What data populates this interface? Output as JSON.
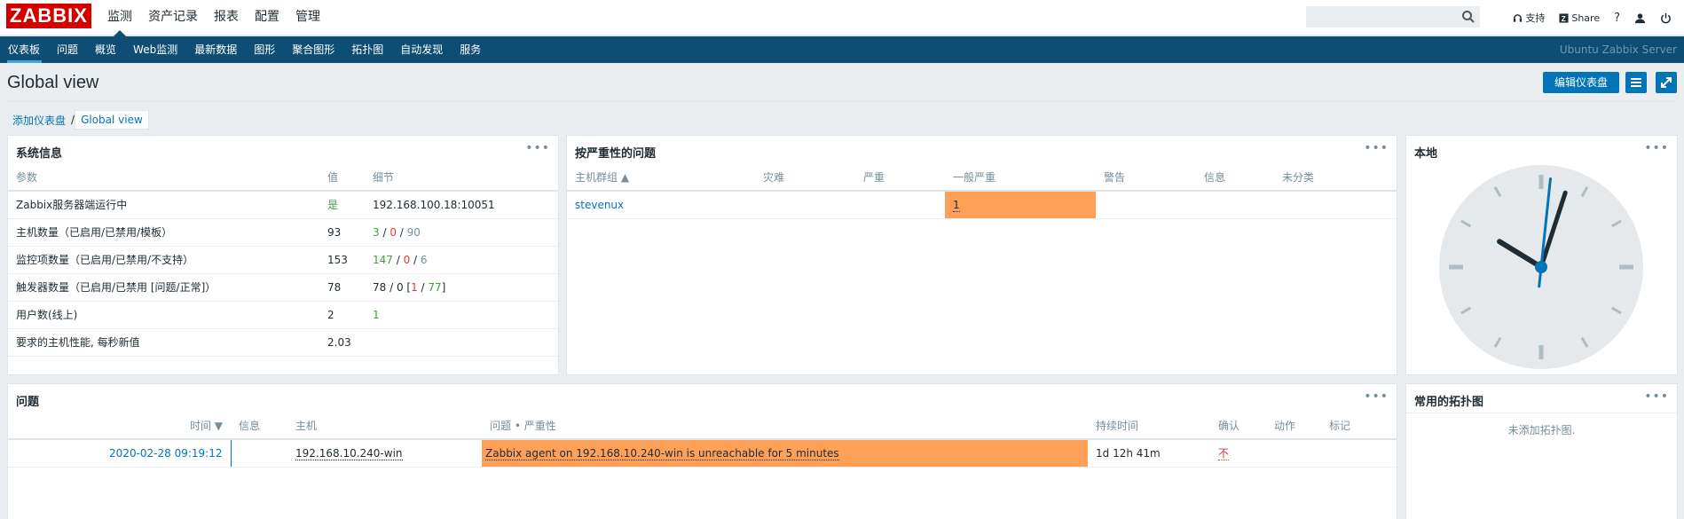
{
  "logo": "ZABBIX",
  "top_menu": [
    {
      "label": "监测",
      "active": true
    },
    {
      "label": "资产记录",
      "active": false
    },
    {
      "label": "报表",
      "active": false
    },
    {
      "label": "配置",
      "active": false
    },
    {
      "label": "管理",
      "active": false
    }
  ],
  "top_links": {
    "support": "支持",
    "share": "Share",
    "help": "?"
  },
  "sub_menu": [
    {
      "label": "仪表板",
      "active": true
    },
    {
      "label": "问题",
      "active": false
    },
    {
      "label": "概览",
      "active": false
    },
    {
      "label": "Web监测",
      "active": false
    },
    {
      "label": "最新数据",
      "active": false
    },
    {
      "label": "图形",
      "active": false
    },
    {
      "label": "聚合图形",
      "active": false
    },
    {
      "label": "拓扑图",
      "active": false
    },
    {
      "label": "自动发现",
      "active": false
    },
    {
      "label": "服务",
      "active": false
    }
  ],
  "server_name": "Ubuntu Zabbix Server",
  "page": {
    "title": "Global view",
    "edit_button": "编辑仪表盘"
  },
  "breadcrumb": {
    "parent": "添加仪表盘",
    "separator": "/",
    "current": "Global view"
  },
  "sysinfo": {
    "title": "系统信息",
    "menu": "•••",
    "columns": [
      "参数",
      "值",
      "细节"
    ],
    "rows": [
      {
        "param": "Zabbix服务器端运行中",
        "value": "是",
        "detail": "192.168.100.18:10051"
      },
      {
        "param": "主机数量（已启用/已禁用/模板）",
        "value": "93",
        "d1": "3",
        "d2": "0",
        "d3": "90"
      },
      {
        "param": "监控项数量（已启用/已禁用/不支持）",
        "value": "153",
        "d1": "147",
        "d2": "0",
        "d3": "6"
      },
      {
        "param": "触发器数量（已启用/已禁用 [问题/正常]）",
        "value": "78",
        "d_pre": "78 / 0 [",
        "d1": "1",
        "d_mid": " / ",
        "d2": "77",
        "d_post": "]"
      },
      {
        "param": "用户数(线上)",
        "value": "2",
        "detail": "1"
      },
      {
        "param": "要求的主机性能, 每秒新值",
        "value": "2.03",
        "detail": ""
      }
    ]
  },
  "severity": {
    "title": "按严重性的问题",
    "menu": "•••",
    "columns": [
      "主机群组 ▲",
      "灾难",
      "严重",
      "一般严重",
      "警告",
      "信息",
      "未分类"
    ],
    "rows": [
      {
        "group": "stevenux",
        "disaster": "",
        "high": "",
        "average": "1",
        "warning": "",
        "info": "",
        "unclassified": ""
      }
    ],
    "colors": {
      "average": "#ffa059"
    }
  },
  "clock": {
    "title": "本地",
    "menu": "•••",
    "time": "10:03"
  },
  "problems": {
    "title": "问题",
    "menu": "•••",
    "columns": {
      "time": "时间 ▼",
      "info": "信息",
      "host": "主机",
      "problem": "问题 • 严重性",
      "duration": "持续时间",
      "ack": "确认",
      "actions": "动作",
      "tags": "标记"
    },
    "rows": [
      {
        "time": "2020-02-28 09:19:12",
        "host": "192.168.10.240-win",
        "problem": "Zabbix agent on 192.168.10.240-win is unreachable for 5 minutes",
        "duration": "1d 12h 41m",
        "ack": "不"
      }
    ]
  },
  "maps": {
    "title": "常用的拓扑图",
    "menu": "•••",
    "empty": "未添加拓扑图."
  }
}
